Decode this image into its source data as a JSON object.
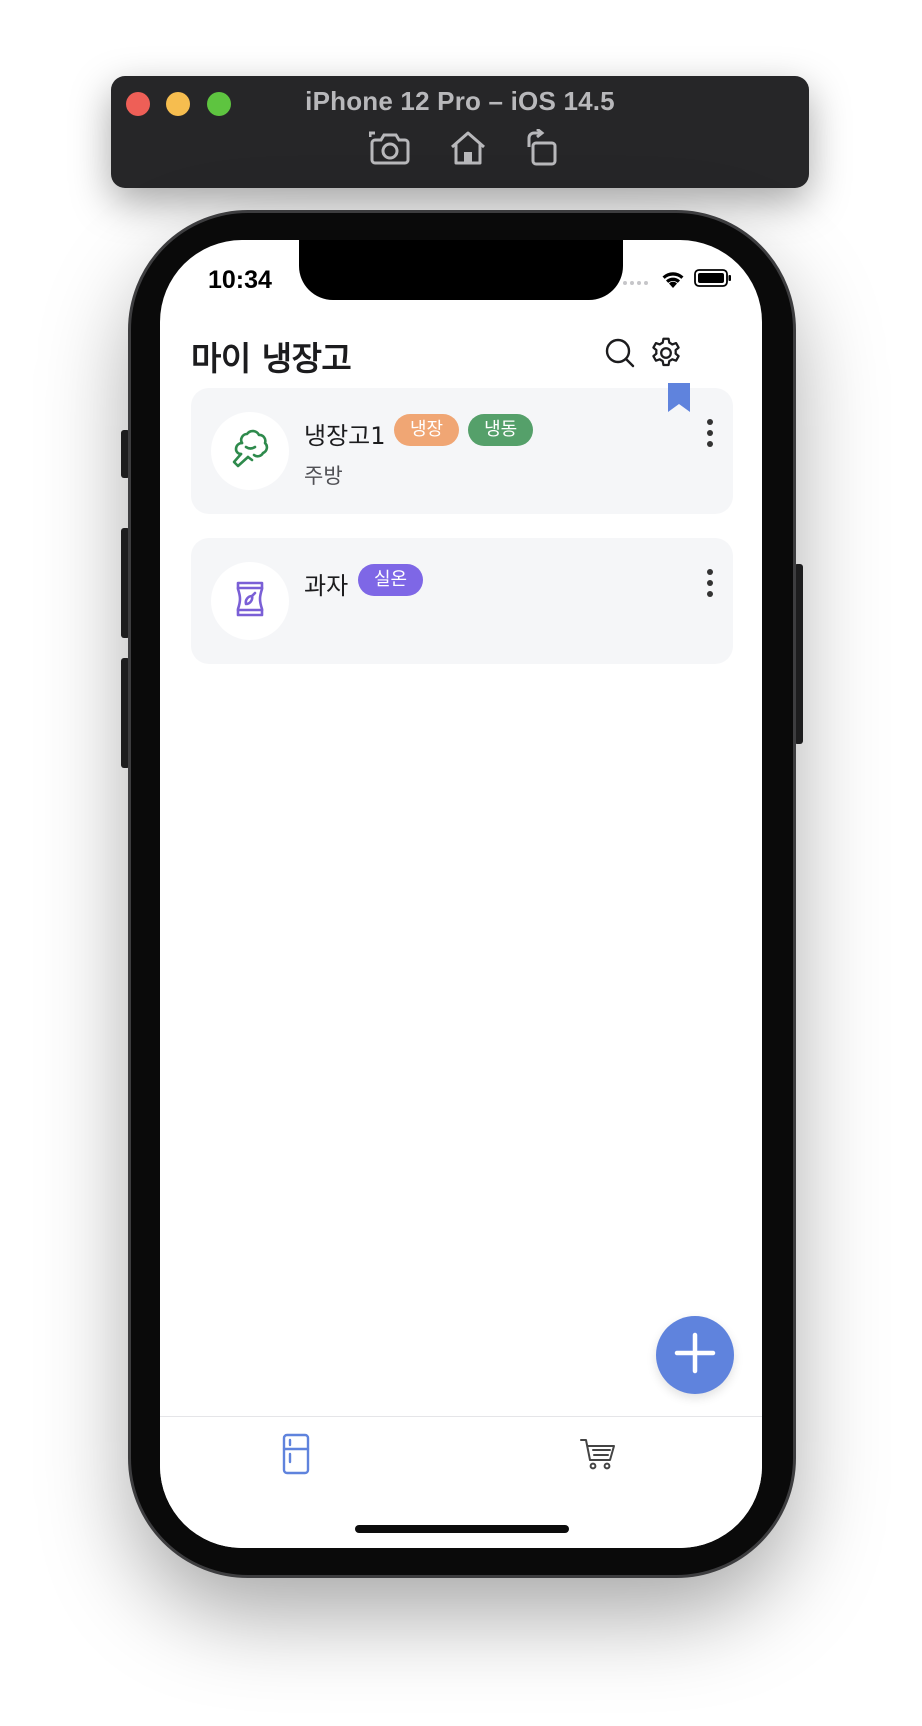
{
  "simulator": {
    "title": "iPhone 12 Pro – iOS 14.5",
    "tools": [
      "screenshot-icon",
      "home-icon",
      "rotate-icon"
    ]
  },
  "status_bar": {
    "time": "10:34"
  },
  "header": {
    "title": "마이 냉장고",
    "icons": [
      "search-icon",
      "gear-icon"
    ]
  },
  "fridges": [
    {
      "name": "냉장고1",
      "icon": "broccoli-icon",
      "location": "주방",
      "bookmarked": true,
      "tags": [
        {
          "label": "냉장",
          "color": "#f0a674"
        },
        {
          "label": "냉동",
          "color": "#55a06a"
        }
      ]
    },
    {
      "name": "과자",
      "icon": "snack-bag-icon",
      "location": "",
      "bookmarked": false,
      "tags": [
        {
          "label": "실온",
          "color": "#7e67e6"
        }
      ]
    }
  ],
  "colors": {
    "accent": "#5f83dd",
    "card_bg": "#f5f6f8",
    "bookmark": "#5f83dd",
    "broccoli": "#2e8a4c",
    "snack": "#7a5fd6"
  },
  "tabbar": {
    "items": [
      {
        "icon": "fridge-icon",
        "active": true
      },
      {
        "icon": "cart-icon",
        "active": false
      }
    ]
  }
}
